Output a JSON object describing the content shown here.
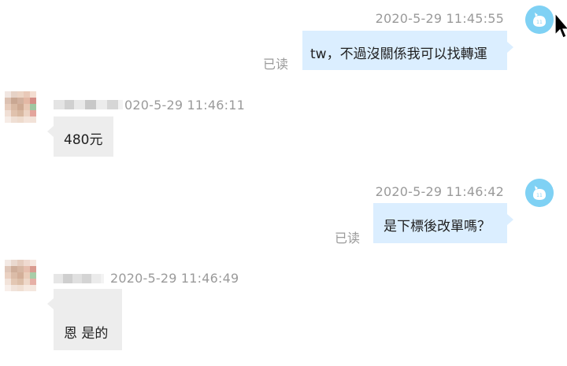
{
  "messages": [
    {
      "direction": "out",
      "timestamp": "2020-5-29 11:45:55",
      "text": "tw，不過沒關係我可以找轉運",
      "status": "已读"
    },
    {
      "direction": "in",
      "timestamp": "020-5-29 11:46:11",
      "text": "480元"
    },
    {
      "direction": "out",
      "timestamp": "2020-5-29 11:46:42",
      "text": "是下標後改單嗎？",
      "status": "已读"
    },
    {
      "direction": "in",
      "timestamp": "2020-5-29 11:46:49",
      "text": "恩 是的"
    }
  ],
  "colors": {
    "outgoing_bubble": "#dbeeff",
    "incoming_bubble": "#ededed",
    "timestamp_text": "#9a9a9a",
    "self_avatar": "#7fd1f4"
  },
  "icons": {
    "self_avatar": "blue-circle-avatar-icon",
    "other_avatar": "pixelated-avatar",
    "cursor": "mouse-pointer-icon"
  }
}
